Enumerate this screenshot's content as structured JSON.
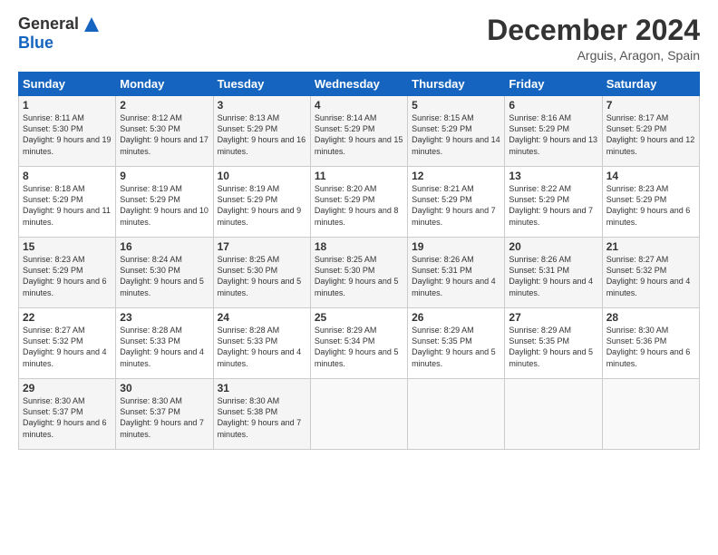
{
  "header": {
    "logo_general": "General",
    "logo_blue": "Blue",
    "title": "December 2024",
    "location": "Arguis, Aragon, Spain"
  },
  "columns": [
    "Sunday",
    "Monday",
    "Tuesday",
    "Wednesday",
    "Thursday",
    "Friday",
    "Saturday"
  ],
  "weeks": [
    [
      {
        "day": "1",
        "sunrise": "8:11 AM",
        "sunset": "5:30 PM",
        "daylight": "9 hours and 19 minutes."
      },
      {
        "day": "2",
        "sunrise": "8:12 AM",
        "sunset": "5:30 PM",
        "daylight": "9 hours and 17 minutes."
      },
      {
        "day": "3",
        "sunrise": "8:13 AM",
        "sunset": "5:29 PM",
        "daylight": "9 hours and 16 minutes."
      },
      {
        "day": "4",
        "sunrise": "8:14 AM",
        "sunset": "5:29 PM",
        "daylight": "9 hours and 15 minutes."
      },
      {
        "day": "5",
        "sunrise": "8:15 AM",
        "sunset": "5:29 PM",
        "daylight": "9 hours and 14 minutes."
      },
      {
        "day": "6",
        "sunrise": "8:16 AM",
        "sunset": "5:29 PM",
        "daylight": "9 hours and 13 minutes."
      },
      {
        "day": "7",
        "sunrise": "8:17 AM",
        "sunset": "5:29 PM",
        "daylight": "9 hours and 12 minutes."
      }
    ],
    [
      {
        "day": "8",
        "sunrise": "8:18 AM",
        "sunset": "5:29 PM",
        "daylight": "9 hours and 11 minutes."
      },
      {
        "day": "9",
        "sunrise": "8:19 AM",
        "sunset": "5:29 PM",
        "daylight": "9 hours and 10 minutes."
      },
      {
        "day": "10",
        "sunrise": "8:19 AM",
        "sunset": "5:29 PM",
        "daylight": "9 hours and 9 minutes."
      },
      {
        "day": "11",
        "sunrise": "8:20 AM",
        "sunset": "5:29 PM",
        "daylight": "9 hours and 8 minutes."
      },
      {
        "day": "12",
        "sunrise": "8:21 AM",
        "sunset": "5:29 PM",
        "daylight": "9 hours and 7 minutes."
      },
      {
        "day": "13",
        "sunrise": "8:22 AM",
        "sunset": "5:29 PM",
        "daylight": "9 hours and 7 minutes."
      },
      {
        "day": "14",
        "sunrise": "8:23 AM",
        "sunset": "5:29 PM",
        "daylight": "9 hours and 6 minutes."
      }
    ],
    [
      {
        "day": "15",
        "sunrise": "8:23 AM",
        "sunset": "5:29 PM",
        "daylight": "9 hours and 6 minutes."
      },
      {
        "day": "16",
        "sunrise": "8:24 AM",
        "sunset": "5:30 PM",
        "daylight": "9 hours and 5 minutes."
      },
      {
        "day": "17",
        "sunrise": "8:25 AM",
        "sunset": "5:30 PM",
        "daylight": "9 hours and 5 minutes."
      },
      {
        "day": "18",
        "sunrise": "8:25 AM",
        "sunset": "5:30 PM",
        "daylight": "9 hours and 5 minutes."
      },
      {
        "day": "19",
        "sunrise": "8:26 AM",
        "sunset": "5:31 PM",
        "daylight": "9 hours and 4 minutes."
      },
      {
        "day": "20",
        "sunrise": "8:26 AM",
        "sunset": "5:31 PM",
        "daylight": "9 hours and 4 minutes."
      },
      {
        "day": "21",
        "sunrise": "8:27 AM",
        "sunset": "5:32 PM",
        "daylight": "9 hours and 4 minutes."
      }
    ],
    [
      {
        "day": "22",
        "sunrise": "8:27 AM",
        "sunset": "5:32 PM",
        "daylight": "9 hours and 4 minutes."
      },
      {
        "day": "23",
        "sunrise": "8:28 AM",
        "sunset": "5:33 PM",
        "daylight": "9 hours and 4 minutes."
      },
      {
        "day": "24",
        "sunrise": "8:28 AM",
        "sunset": "5:33 PM",
        "daylight": "9 hours and 4 minutes."
      },
      {
        "day": "25",
        "sunrise": "8:29 AM",
        "sunset": "5:34 PM",
        "daylight": "9 hours and 5 minutes."
      },
      {
        "day": "26",
        "sunrise": "8:29 AM",
        "sunset": "5:35 PM",
        "daylight": "9 hours and 5 minutes."
      },
      {
        "day": "27",
        "sunrise": "8:29 AM",
        "sunset": "5:35 PM",
        "daylight": "9 hours and 5 minutes."
      },
      {
        "day": "28",
        "sunrise": "8:30 AM",
        "sunset": "5:36 PM",
        "daylight": "9 hours and 6 minutes."
      }
    ],
    [
      {
        "day": "29",
        "sunrise": "8:30 AM",
        "sunset": "5:37 PM",
        "daylight": "9 hours and 6 minutes."
      },
      {
        "day": "30",
        "sunrise": "8:30 AM",
        "sunset": "5:37 PM",
        "daylight": "9 hours and 7 minutes."
      },
      {
        "day": "31",
        "sunrise": "8:30 AM",
        "sunset": "5:38 PM",
        "daylight": "9 hours and 7 minutes."
      },
      null,
      null,
      null,
      null
    ]
  ]
}
